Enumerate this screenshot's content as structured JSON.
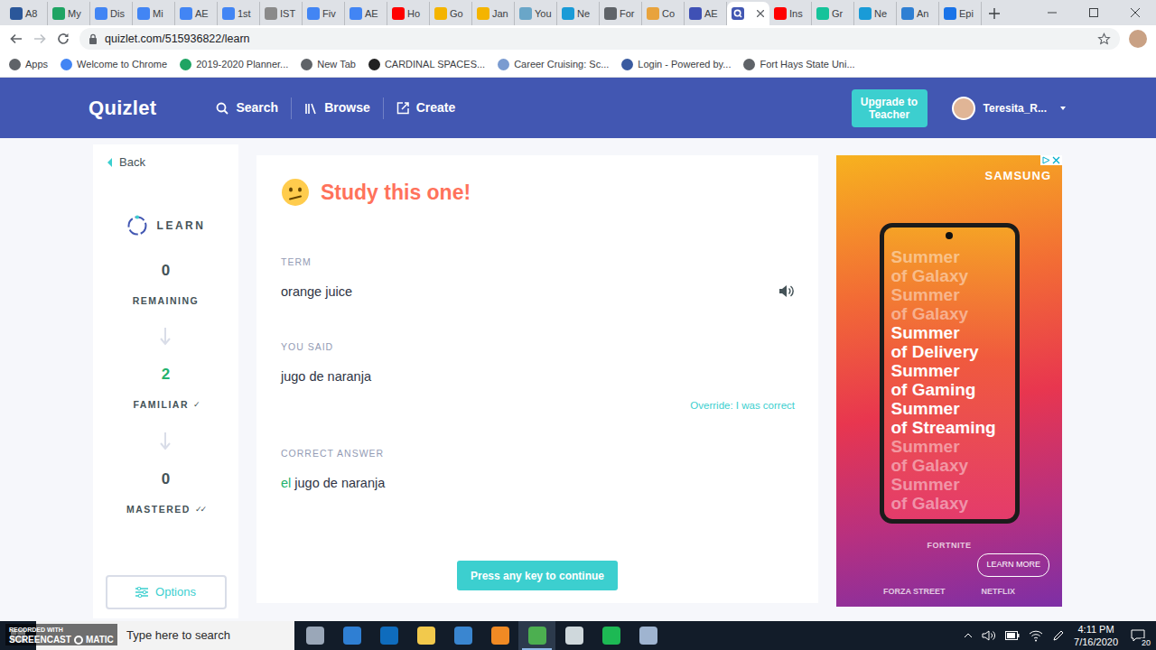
{
  "browser": {
    "tabs": [
      {
        "label": "A8",
        "selected": false,
        "color": "#2b579a"
      },
      {
        "label": "My",
        "selected": false,
        "color": "#1fa463"
      },
      {
        "label": "Dis",
        "selected": false,
        "color": "#4285f4"
      },
      {
        "label": "Mi",
        "selected": false,
        "color": "#4285f4"
      },
      {
        "label": "AE",
        "selected": false,
        "color": "#4285f4"
      },
      {
        "label": "1st",
        "selected": false,
        "color": "#4285f4"
      },
      {
        "label": "IST",
        "selected": false,
        "color": "#8a8a8a"
      },
      {
        "label": "Fiv",
        "selected": false,
        "color": "#4285f4"
      },
      {
        "label": "AE",
        "selected": false,
        "color": "#4285f4"
      },
      {
        "label": "Ho",
        "selected": false,
        "color": "#ff0000"
      },
      {
        "label": "Go",
        "selected": false,
        "color": "#f4b400"
      },
      {
        "label": "Jan",
        "selected": false,
        "color": "#f4b400"
      },
      {
        "label": "You",
        "selected": false,
        "color": "#6aa6c8"
      },
      {
        "label": "Ne",
        "selected": false,
        "color": "#1a9bd7"
      },
      {
        "label": "For",
        "selected": false,
        "color": "#5f6368"
      },
      {
        "label": "Co",
        "selected": false,
        "color": "#e8a33d"
      },
      {
        "label": "AE",
        "selected": false,
        "color": "#3f51b5"
      },
      {
        "selected": true,
        "color": "#4257b2"
      },
      {
        "label": "Ins",
        "selected": false,
        "color": "#ff0000"
      },
      {
        "label": "Gr",
        "selected": false,
        "color": "#15c39a"
      },
      {
        "label": "Ne",
        "selected": false,
        "color": "#1a9bd7"
      },
      {
        "label": "An",
        "selected": false,
        "color": "#2f7fd3"
      },
      {
        "label": "Epi",
        "selected": false,
        "color": "#1a73e8"
      }
    ],
    "address": "quizlet.com/515936822/learn",
    "bookmarks": [
      {
        "label": "Apps",
        "color": "#5f6368"
      },
      {
        "label": "Welcome to Chrome",
        "color": "#4285f4"
      },
      {
        "label": "2019-2020 Planner...",
        "color": "#1fa463"
      },
      {
        "label": "New Tab",
        "color": "#5f6368"
      },
      {
        "label": "CARDINAL SPACES...",
        "color": "#222222"
      },
      {
        "label": "Career Cruising: Sc...",
        "color": "#7a9bd0"
      },
      {
        "label": "Login - Powered by...",
        "color": "#3a5ba0"
      },
      {
        "label": "Fort Hays State Uni...",
        "color": "#5f6368"
      }
    ]
  },
  "site": {
    "logo": "Quizlet",
    "nav": [
      {
        "label": "Search"
      },
      {
        "label": "Browse"
      },
      {
        "label": "Create"
      }
    ],
    "upgrade": "Upgrade to Teacher",
    "user": "Teresita_R..."
  },
  "sidebar": {
    "back": "Back",
    "mode": "LEARN",
    "stats": [
      {
        "count": "0",
        "label": "REMAINING",
        "color": "#455358"
      },
      {
        "count": "2",
        "label": "FAMILIAR",
        "color": "#23b26d",
        "tick": "✓"
      },
      {
        "count": "0",
        "label": "MASTERED",
        "color": "#455358",
        "tick": "✓✓"
      }
    ],
    "options": "Options"
  },
  "card": {
    "title": "Study this one!",
    "term_label": "TERM",
    "term": "orange juice",
    "said_label": "YOU SAID",
    "said": "jugo de naranja",
    "override": "Override: I was correct",
    "answer_label": "CORRECT ANSWER",
    "answer": [
      {
        "text": "el",
        "added": true
      },
      {
        "text": "jugo de naranja",
        "added": false
      }
    ],
    "continue": "Press any key to continue"
  },
  "ad": {
    "brand": "SAMSUNG",
    "lines": [
      {
        "text": "Summer",
        "faded": true
      },
      {
        "text": "of Galaxy",
        "faded": true
      },
      {
        "text": "Summer",
        "faded": true
      },
      {
        "text": "of Galaxy",
        "faded": true
      },
      {
        "text": "Summer",
        "faded": false
      },
      {
        "text": "of Delivery",
        "faded": false
      },
      {
        "text": "Summer",
        "faded": false
      },
      {
        "text": "of Gaming",
        "faded": false
      },
      {
        "text": "Summer",
        "faded": false
      },
      {
        "text": "of Streaming",
        "faded": false
      },
      {
        "text": "Summer",
        "faded": true
      },
      {
        "text": "of Galaxy",
        "faded": true
      },
      {
        "text": "Summer",
        "faded": true
      },
      {
        "text": "of Galaxy",
        "faded": true
      }
    ],
    "badge": "FORTNITE",
    "cta": "LEARN MORE",
    "footer": [
      "FORZA STREET",
      "NETFLIX"
    ]
  },
  "taskbar": {
    "search": "Type here to search",
    "apps": [
      {
        "color": "#9aa7b8",
        "selected": false
      },
      {
        "color": "#2f7fd3",
        "selected": false
      },
      {
        "color": "#0f6cbd",
        "selected": false
      },
      {
        "color": "#f2c94c",
        "selected": false
      },
      {
        "color": "#3a86d0",
        "selected": false
      },
      {
        "color": "#f08a24",
        "selected": false
      },
      {
        "color": "#4caf50",
        "selected": true
      },
      {
        "color": "#cfd8dc",
        "selected": false
      },
      {
        "color": "#1db954",
        "selected": false
      },
      {
        "color": "#9fb4d0",
        "selected": false
      }
    ],
    "time": "4:11 PM",
    "date": "7/16/2020",
    "notifications": "20"
  },
  "watermark": {
    "top": "RECORDED WITH",
    "left": "SCREENCAST",
    "right": "MATIC"
  }
}
